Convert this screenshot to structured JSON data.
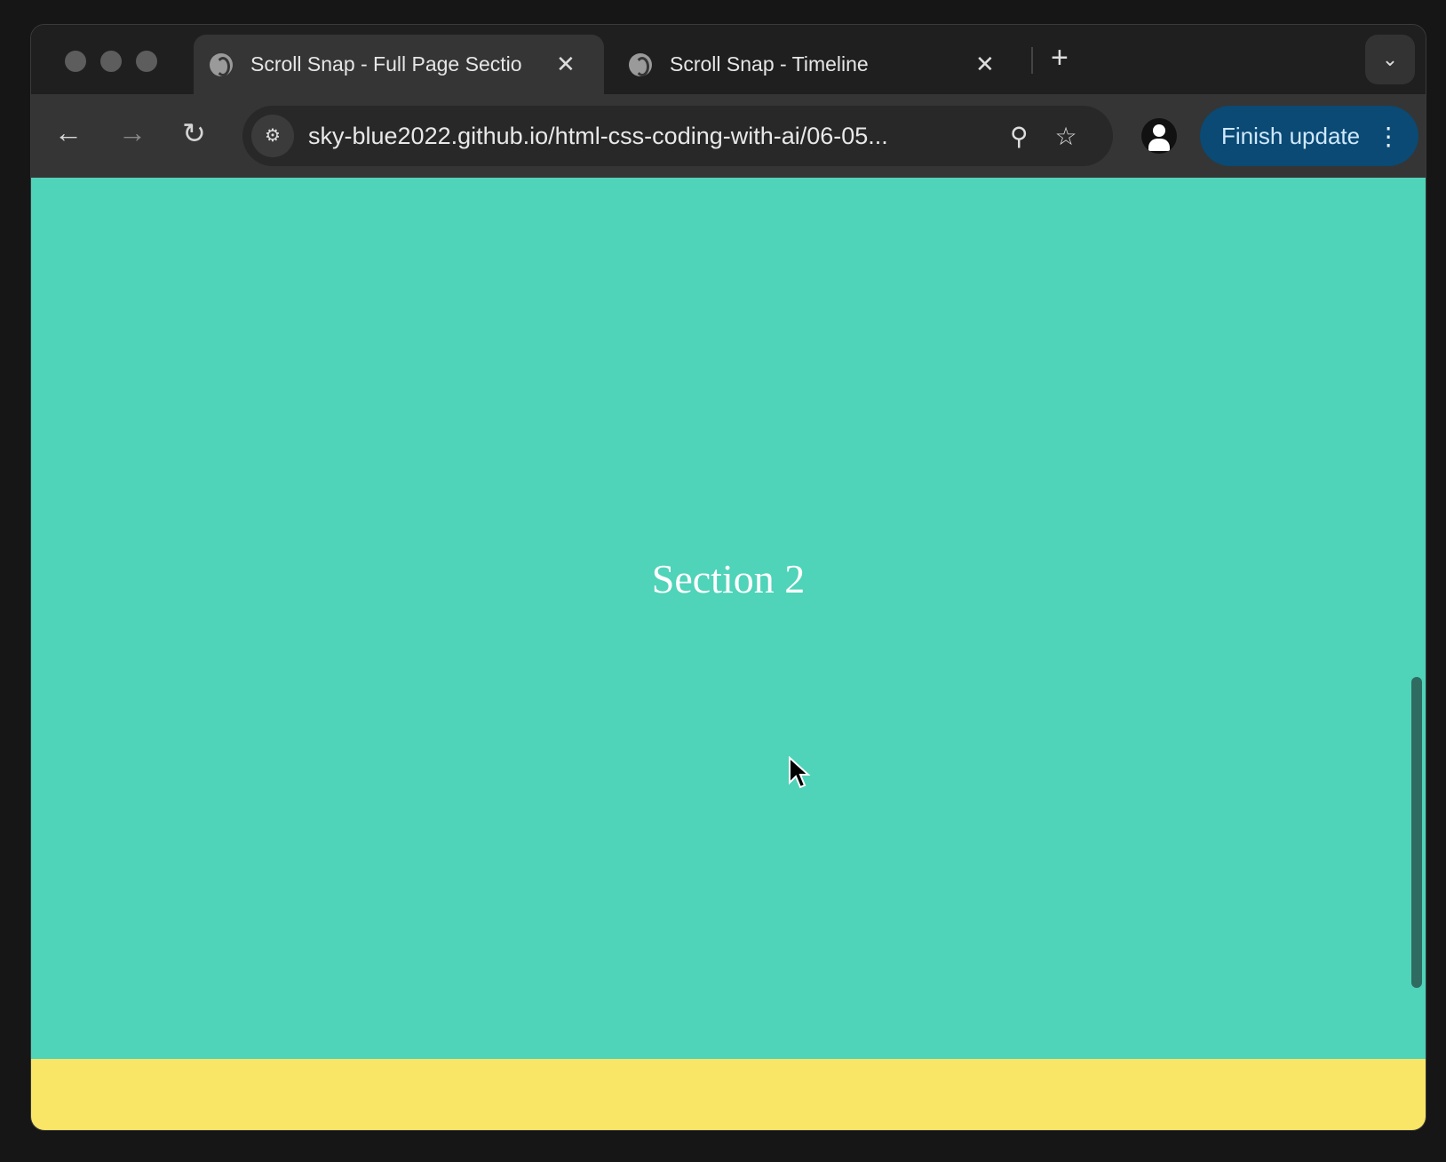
{
  "browser": {
    "tabs": [
      {
        "title": "Scroll Snap - Full Page Sectio",
        "active": true
      },
      {
        "title": "Scroll Snap - Timeline",
        "active": false
      }
    ],
    "close_glyph": "✕",
    "new_tab_glyph": "+",
    "tab_menu_glyph": "⌄",
    "url": "sky-blue2022.github.io/html-css-coding-with-ai/06-05...",
    "update_button": "Finish update",
    "accent": "#0a4a74"
  },
  "page": {
    "section_title": "Section 2",
    "section_color": "#4fd3b9",
    "next_section_color": "#f9e666"
  }
}
